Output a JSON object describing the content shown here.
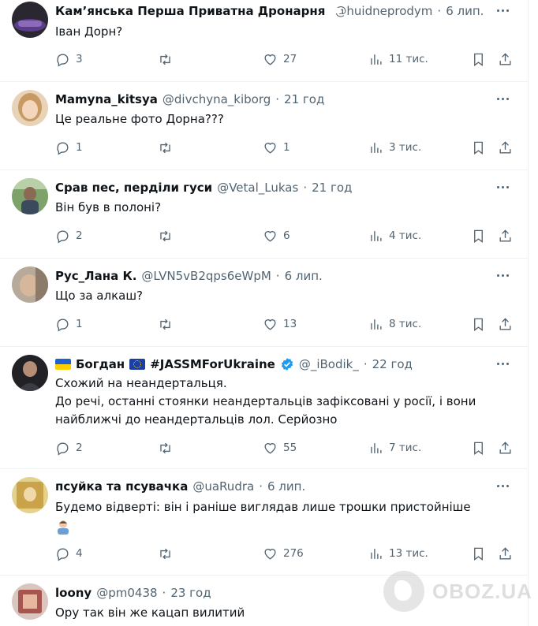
{
  "tweets": [
    {
      "name": "Кам’янська Перша Приватна Дронарня",
      "handle": "@huidneprodym",
      "time": "6 лип.",
      "text": [
        "Іван Дорн?"
      ],
      "replies": "3",
      "retweets": "",
      "likes": "27",
      "views": "11 тис."
    },
    {
      "name": "Mamyna_kitsya",
      "handle": "@divchyna_kiborg",
      "time": "21 год",
      "text": [
        "Це реальне фото Дорна???"
      ],
      "replies": "1",
      "retweets": "",
      "likes": "1",
      "views": "3 тис."
    },
    {
      "name": "Срав пес, перділи гуси",
      "handle": "@Vetal_Lukas",
      "time": "21 год",
      "text": [
        "Він був в полоні?"
      ],
      "replies": "2",
      "retweets": "",
      "likes": "6",
      "views": "4 тис."
    },
    {
      "name": "Рус_Лана К.",
      "handle": "@LVN5vB2qps6eWpM",
      "time": "6 лип.",
      "text": [
        "Що за алкаш?"
      ],
      "replies": "1",
      "retweets": "",
      "likes": "13",
      "views": "8 тис."
    },
    {
      "name": "Богдан",
      "name_suffix": "#JASSMForUkraine",
      "handle": "@_iBodik_",
      "time": "22 год",
      "text": [
        "Схожий на неандертальця.",
        "До речі, останні стоянки неандертальців зафіксовані у росії, і вони",
        "найближчі до неандертальців лол. Серйозно"
      ],
      "replies": "2",
      "retweets": "",
      "likes": "55",
      "views": "7 тис."
    },
    {
      "name": "псуйка та псувачка",
      "handle": "@uaRudra",
      "time": "6 лип.",
      "text": [
        "Будемо відверті: він і раніше виглядав лише трошки пристойніше"
      ],
      "replies": "4",
      "retweets": "",
      "likes": "276",
      "views": "13 тис."
    },
    {
      "name": "loony",
      "handle": "@pm0438",
      "time": "23 год",
      "text": [
        "Ору так він же кацап вилитий"
      ]
    }
  ],
  "separator": "·",
  "watermark": "OBOZ.UA",
  "colors": {
    "text": "#0f1419",
    "secondary": "#536471",
    "verified": "#1d9bf0",
    "divider": "#eff3f4"
  }
}
